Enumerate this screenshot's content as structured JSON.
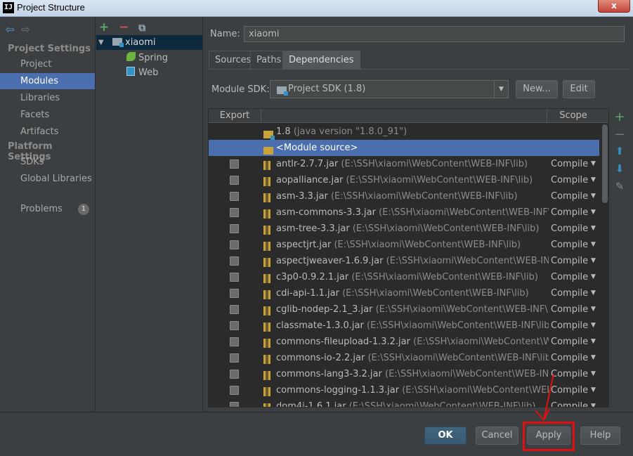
{
  "window": {
    "title": "Project Structure",
    "app_icon": "IJ",
    "close_glyph": "x"
  },
  "nav": {
    "back_icon": "back-arrow-icon",
    "forward_icon": "forward-arrow-icon",
    "project_settings_header": "Project Settings",
    "project_items": [
      "Project",
      "Modules",
      "Libraries",
      "Facets",
      "Artifacts"
    ],
    "selected": "Modules",
    "platform_settings_header": "Platform Settings",
    "platform_items": [
      "SDKs",
      "Global Libraries"
    ],
    "problems_label": "Problems",
    "problems_count": "1"
  },
  "tree": {
    "toolbar_add": "+",
    "toolbar_remove": "−",
    "toolbar_copy": "⧉",
    "root": "xiaomi",
    "children": [
      "Spring",
      "Web"
    ]
  },
  "module": {
    "name_label": "Name:",
    "name_value": "xiaomi",
    "tabs": [
      "Sources",
      "Paths",
      "Dependencies"
    ],
    "active_tab": "Dependencies",
    "sdk_label": "Module SDK:",
    "sdk_value": "Project SDK (1.8)",
    "new_button": "New...",
    "edit_button": "Edit"
  },
  "table": {
    "col_export": "Export",
    "col_scope": "Scope",
    "sdk_row": {
      "name": "1.8",
      "detail": "(java version \"1.8.0_91\")"
    },
    "source_row": "<Module source>",
    "rows": [
      {
        "jar": "antlr-2.7.7.jar",
        "path": "(E:\\SSH\\xiaomi\\WebContent\\WEB-INF\\lib)",
        "scope": "Compile"
      },
      {
        "jar": "aopalliance.jar",
        "path": "(E:\\SSH\\xiaomi\\WebContent\\WEB-INF\\lib)",
        "scope": "Compile"
      },
      {
        "jar": "asm-3.3.jar",
        "path": "(E:\\SSH\\xiaomi\\WebContent\\WEB-INF\\lib)",
        "scope": "Compile"
      },
      {
        "jar": "asm-commons-3.3.jar",
        "path": "(E:\\SSH\\xiaomi\\WebContent\\WEB-INF\\lib)",
        "scope": "Compile"
      },
      {
        "jar": "asm-tree-3.3.jar",
        "path": "(E:\\SSH\\xiaomi\\WebContent\\WEB-INF\\lib)",
        "scope": "Compile"
      },
      {
        "jar": "aspectjrt.jar",
        "path": "(E:\\SSH\\xiaomi\\WebContent\\WEB-INF\\lib)",
        "scope": "Compile"
      },
      {
        "jar": "aspectjweaver-1.6.9.jar",
        "path": "(E:\\SSH\\xiaomi\\WebContent\\WEB-INF\\lib)",
        "scope": "Compile"
      },
      {
        "jar": "c3p0-0.9.2.1.jar",
        "path": "(E:\\SSH\\xiaomi\\WebContent\\WEB-INF\\lib)",
        "scope": "Compile"
      },
      {
        "jar": "cdi-api-1.1.jar",
        "path": "(E:\\SSH\\xiaomi\\WebContent\\WEB-INF\\lib)",
        "scope": "Compile"
      },
      {
        "jar": "cglib-nodep-2.1_3.jar",
        "path": "(E:\\SSH\\xiaomi\\WebContent\\WEB-INF\\lib)",
        "scope": "Compile"
      },
      {
        "jar": "classmate-1.3.0.jar",
        "path": "(E:\\SSH\\xiaomi\\WebContent\\WEB-INF\\lib)",
        "scope": "Compile"
      },
      {
        "jar": "commons-fileupload-1.3.2.jar",
        "path": "(E:\\SSH\\xiaomi\\WebContent\\WEB-IN",
        "scope": "Compile"
      },
      {
        "jar": "commons-io-2.2.jar",
        "path": "(E:\\SSH\\xiaomi\\WebContent\\WEB-INF\\lib)",
        "scope": "Compile"
      },
      {
        "jar": "commons-lang3-3.2.jar",
        "path": "(E:\\SSH\\xiaomi\\WebContent\\WEB-INF\\lib)",
        "scope": "Compile"
      },
      {
        "jar": "commons-logging-1.1.3.jar",
        "path": "(E:\\SSH\\xiaomi\\WebContent\\WEB-INF\\",
        "scope": "Compile"
      },
      {
        "jar": "dom4j-1.6.1.jar",
        "path": "(E:\\SSH\\xiaomi\\WebContent\\WEB-INF\\lib)",
        "scope": "Compile"
      }
    ]
  },
  "side_tools": {
    "add": "+",
    "remove": "−",
    "up": "⬆",
    "down": "⬇",
    "edit": "✎"
  },
  "footer": {
    "ok": "OK",
    "cancel": "Cancel",
    "apply": "Apply",
    "help": "Help"
  },
  "colors": {
    "selection": "#4b6eaf",
    "background": "#3c3f41",
    "table_bg": "#2b2b2b",
    "annotation_red": "#e01010"
  }
}
